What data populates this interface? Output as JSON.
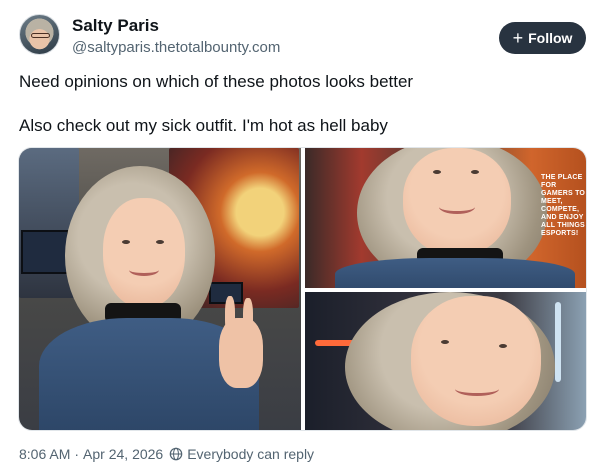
{
  "author": {
    "display_name": "Salty Paris",
    "handle": "@saltyparis.thetotalbounty.com",
    "avatar_icon": "profile-photo"
  },
  "follow_button": {
    "label": "Follow",
    "icon": "plus-icon"
  },
  "post": {
    "lines": [
      "Need opinions on which of these photos looks better",
      "Also check out my sick outfit. I'm hot as hell baby"
    ]
  },
  "media": {
    "photos": [
      {
        "name": "photo-1"
      },
      {
        "name": "photo-2",
        "poster_text": "THE PLACE FOR GAMERS TO MEET, COMPETE, AND ENJOY ALL THINGS ESPORTS!"
      },
      {
        "name": "photo-3"
      }
    ]
  },
  "footer": {
    "time": "8:06 AM",
    "separator": "·",
    "date": "Apr 24, 2026",
    "reply_setting": "Everybody can reply",
    "reply_icon": "globe-icon"
  },
  "colors": {
    "follow_bg": "#283340",
    "text_primary": "#0f1419",
    "text_secondary": "#536471"
  }
}
